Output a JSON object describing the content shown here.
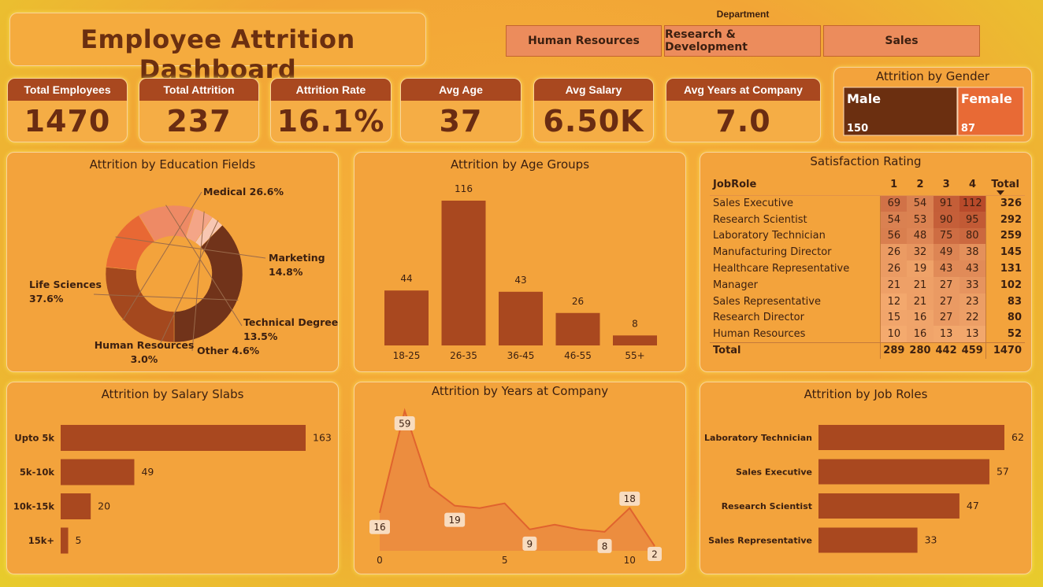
{
  "dashboard": {
    "title": "Employee Attrition Dashboard",
    "department_label": "Department",
    "departments": [
      "Human Resources",
      "Research & Development",
      "Sales"
    ]
  },
  "kpis": [
    {
      "label": "Total Employees",
      "value": "1470"
    },
    {
      "label": "Total Attrition",
      "value": "237"
    },
    {
      "label": "Attrition Rate",
      "value": "16.1%"
    },
    {
      "label": "Avg Age",
      "value": "37"
    },
    {
      "label": "Avg Salary",
      "value": "6.50K"
    },
    {
      "label": "Avg Years at Company",
      "value": "7.0"
    }
  ],
  "colors": {
    "dark_brown": "#6b2f10",
    "bar_brown": "#a9481f",
    "orange": "#e86a35",
    "light_orange": "#ee8a65",
    "pale": "#f6b49a"
  },
  "chart_data": [
    {
      "type": "treemap",
      "title": "Attrition by Gender",
      "categories": [
        "Male",
        "Female"
      ],
      "values": [
        150,
        87
      ]
    },
    {
      "type": "pie",
      "title": "Attrition by Education Fields",
      "categories": [
        "Life Sciences",
        "Medical",
        "Marketing",
        "Technical Degree",
        "Other",
        "Human Resources"
      ],
      "values": [
        37.6,
        26.6,
        14.8,
        13.5,
        4.6,
        3.0
      ],
      "labels": [
        "37.6%",
        "Medical 26.6%",
        "14.8%",
        "13.5%",
        "Other 4.6%",
        "3.0%"
      ],
      "label_names": [
        "Life Sciences",
        "",
        "Marketing",
        "Technical Degree",
        "",
        "Human Resources"
      ]
    },
    {
      "type": "bar",
      "title": "Attrition by Age Groups",
      "categories": [
        "18-25",
        "26-35",
        "36-45",
        "46-55",
        "55+"
      ],
      "values": [
        44,
        116,
        43,
        26,
        8
      ]
    },
    {
      "type": "table",
      "title": "Satisfaction Rating",
      "header": [
        "JobRole",
        "1",
        "2",
        "3",
        "4",
        "Total"
      ],
      "rows": [
        {
          "role": "Sales Executive",
          "values": [
            69,
            54,
            91,
            112
          ],
          "total": 326
        },
        {
          "role": "Research Scientist",
          "values": [
            54,
            53,
            90,
            95
          ],
          "total": 292
        },
        {
          "role": "Laboratory Technician",
          "values": [
            56,
            48,
            75,
            80
          ],
          "total": 259
        },
        {
          "role": "Manufacturing Director",
          "values": [
            26,
            32,
            49,
            38
          ],
          "total": 145
        },
        {
          "role": "Healthcare Representative",
          "values": [
            26,
            19,
            43,
            43
          ],
          "total": 131
        },
        {
          "role": "Manager",
          "values": [
            21,
            21,
            27,
            33
          ],
          "total": 102
        },
        {
          "role": "Sales Representative",
          "values": [
            12,
            21,
            27,
            23
          ],
          "total": 83
        },
        {
          "role": "Research Director",
          "values": [
            15,
            16,
            27,
            22
          ],
          "total": 80
        },
        {
          "role": "Human Resources",
          "values": [
            10,
            16,
            13,
            13
          ],
          "total": 52
        }
      ],
      "totals": {
        "label": "Total",
        "values": [
          289,
          280,
          442,
          459
        ],
        "total": 1470
      }
    },
    {
      "type": "bar",
      "orientation": "horizontal",
      "title": "Attrition by Salary Slabs",
      "categories": [
        "Upto 5k",
        "5k-10k",
        "10k-15k",
        "15k+"
      ],
      "values": [
        163,
        49,
        20,
        5
      ]
    },
    {
      "type": "area",
      "title": "Attrition by Years at Company",
      "x": [
        0,
        1,
        2,
        3,
        4,
        5,
        6,
        7,
        8,
        9,
        10,
        11
      ],
      "y": [
        16,
        59,
        27,
        19,
        18,
        20,
        9,
        11,
        9,
        8,
        18,
        2
      ],
      "labeled_points": [
        0,
        1,
        3,
        6,
        9,
        10,
        11
      ],
      "xticks": [
        0,
        5,
        10
      ]
    },
    {
      "type": "bar",
      "orientation": "horizontal",
      "title": "Attrition by Job Roles",
      "categories": [
        "Laboratory Technician",
        "Sales Executive",
        "Research Scientist",
        "Sales Representative"
      ],
      "values": [
        62,
        57,
        47,
        33
      ]
    }
  ]
}
